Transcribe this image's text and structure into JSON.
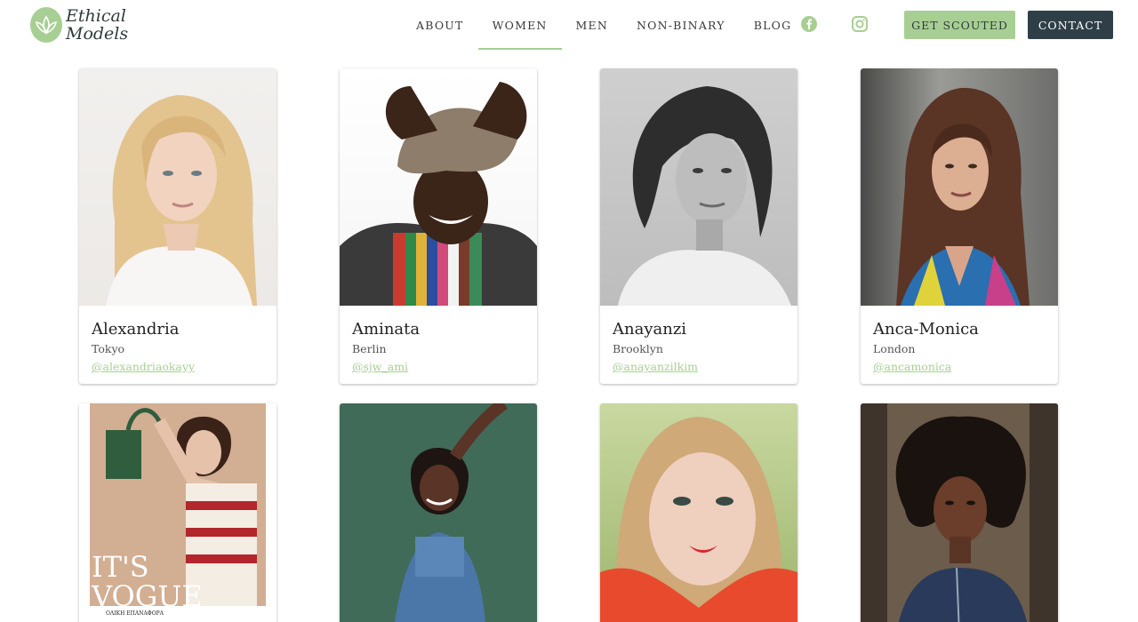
{
  "brand": {
    "line1": "Ethical",
    "line2": "Models"
  },
  "nav": {
    "items": [
      {
        "label": "About",
        "active": false
      },
      {
        "label": "Women",
        "active": true
      },
      {
        "label": "Men",
        "active": false
      },
      {
        "label": "Non-Binary",
        "active": false
      },
      {
        "label": "Blog",
        "active": false
      }
    ],
    "social": [
      "facebook-icon",
      "instagram-icon"
    ],
    "get_scouted": "Get Scouted",
    "contact": "Contact"
  },
  "colors": {
    "accent": "#a8cf93",
    "dark": "#2f3f47"
  },
  "models": [
    {
      "name": "Alexandria",
      "city": "Tokyo",
      "handle": "@alexandriaokayy"
    },
    {
      "name": "Aminata",
      "city": "Berlin",
      "handle": "@sjw_ami"
    },
    {
      "name": "Anayanzi",
      "city": "Brooklyn",
      "handle": "@anayanzilkim"
    },
    {
      "name": "Anca-Monica",
      "city": "London",
      "handle": "@ancamonica"
    }
  ],
  "magazine": {
    "headline1": "IT'S",
    "headline2": "VOGUE",
    "caption": "ΟΛΙΚΗ ΕΠΑΝΑΦΟΡΑ"
  }
}
